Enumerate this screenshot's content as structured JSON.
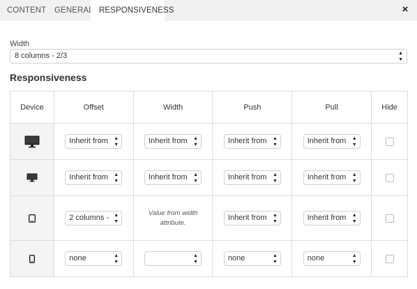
{
  "tabs": [
    {
      "label": "CONTENT",
      "active": false
    },
    {
      "label": "GENERAL",
      "active": false
    },
    {
      "label": "RESPONSIVENESS",
      "active": true
    }
  ],
  "close_label": "×",
  "width_field": {
    "label": "Width",
    "value": "8 columns - 2/3"
  },
  "section_title": "Responsiveness",
  "table": {
    "headers": [
      "Device",
      "Offset",
      "Width",
      "Push",
      "Pull",
      "Hide"
    ],
    "rows": [
      {
        "device_icon": "desktop-large-icon",
        "offset": "Inherit from",
        "width": "Inherit from",
        "push": "Inherit from",
        "pull": "Inherit from",
        "hide": false
      },
      {
        "device_icon": "desktop-small-icon",
        "offset": "Inherit from",
        "width": "Inherit from",
        "push": "Inherit from",
        "pull": "Inherit from",
        "hide": false
      },
      {
        "device_icon": "tablet-icon",
        "offset": "2 columns -",
        "width_note_line1": "Value from width",
        "width_note_line2": "attribute.",
        "push": "Inherit from",
        "pull": "Inherit from",
        "hide": false
      },
      {
        "device_icon": "mobile-icon",
        "offset": "none",
        "width": "",
        "push": "none",
        "pull": "none",
        "hide": false
      }
    ]
  },
  "colors": {
    "tab_bar_bg": "#f1f1f1",
    "device_cell_bg": "#f4f4f4",
    "border": "#dcdcdc"
  }
}
